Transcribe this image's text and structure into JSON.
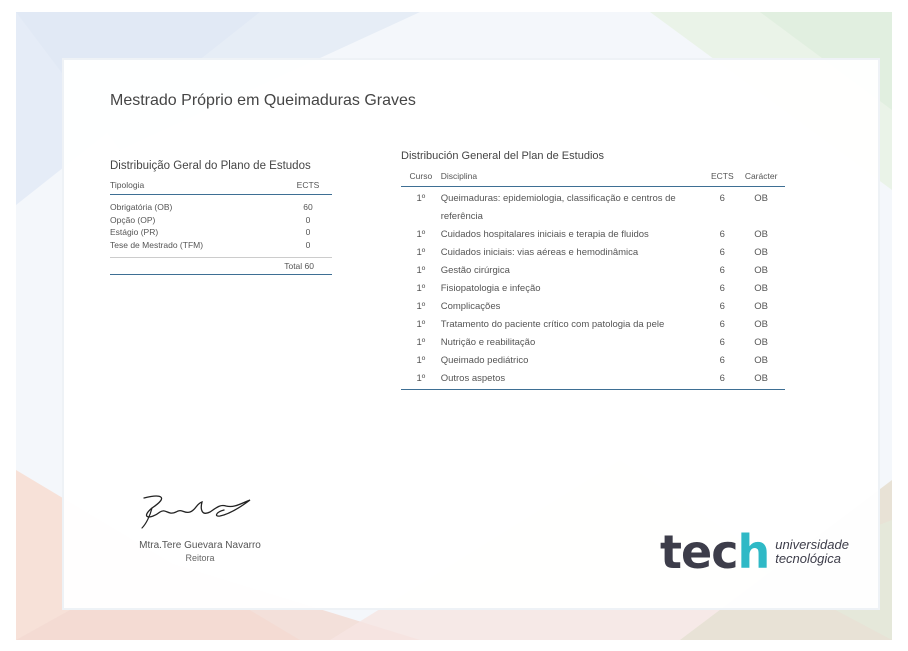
{
  "title": "Mestrado Próprio em Queimaduras Graves",
  "summary": {
    "heading": "Distribuição Geral do Plano de Estudos",
    "col_tipologia": "Tipologia",
    "col_ects": "ECTS",
    "rows": [
      {
        "label": "Obrigatória (OB)",
        "ects": "60"
      },
      {
        "label": "Opção (OP)",
        "ects": "0"
      },
      {
        "label": "Estágio (PR)",
        "ects": "0"
      },
      {
        "label": "Tese de Mestrado (TFM)",
        "ects": "0"
      }
    ],
    "total": "Total 60"
  },
  "detail": {
    "heading": "Distribución General del Plan de Estudios",
    "headers": {
      "curso": "Curso",
      "disciplina": "Disciplina",
      "ects": "ECTS",
      "caracter": "Carácter"
    },
    "rows": [
      {
        "curso": "1º",
        "disciplina": "Queimaduras: epidemiologia, classificação e centros de referência",
        "ects": "6",
        "caracter": "OB"
      },
      {
        "curso": "1º",
        "disciplina": "Cuidados hospitalares iniciais e terapia de fluidos",
        "ects": "6",
        "caracter": "OB"
      },
      {
        "curso": "1º",
        "disciplina": "Cuidados iniciais: vias aéreas e hemodinâmica",
        "ects": "6",
        "caracter": "OB"
      },
      {
        "curso": "1º",
        "disciplina": "Gestão cirúrgica",
        "ects": "6",
        "caracter": "OB"
      },
      {
        "curso": "1º",
        "disciplina": "Fisiopatologia e infeção",
        "ects": "6",
        "caracter": "OB"
      },
      {
        "curso": "1º",
        "disciplina": "Complicações",
        "ects": "6",
        "caracter": "OB"
      },
      {
        "curso": "1º",
        "disciplina": "Tratamento do paciente crítico com patologia da pele",
        "ects": "6",
        "caracter": "OB"
      },
      {
        "curso": "1º",
        "disciplina": "Nutrição e reabilitação",
        "ects": "6",
        "caracter": "OB"
      },
      {
        "curso": "1º",
        "disciplina": "Queimado pediátrico",
        "ects": "6",
        "caracter": "OB"
      },
      {
        "curso": "1º",
        "disciplina": "Outros aspetos",
        "ects": "6",
        "caracter": "OB"
      }
    ]
  },
  "signature": {
    "name": "Mtra.Tere Guevara Navarro",
    "role": "Reitora"
  },
  "logo": {
    "mark_part1": "tec",
    "mark_part2": "h",
    "line1": "universidade",
    "line2": "tecnológica"
  },
  "colors": {
    "accent": "#3e6f94",
    "logo_dark": "#3d3d4a",
    "logo_teal": "#2fb9c6"
  }
}
